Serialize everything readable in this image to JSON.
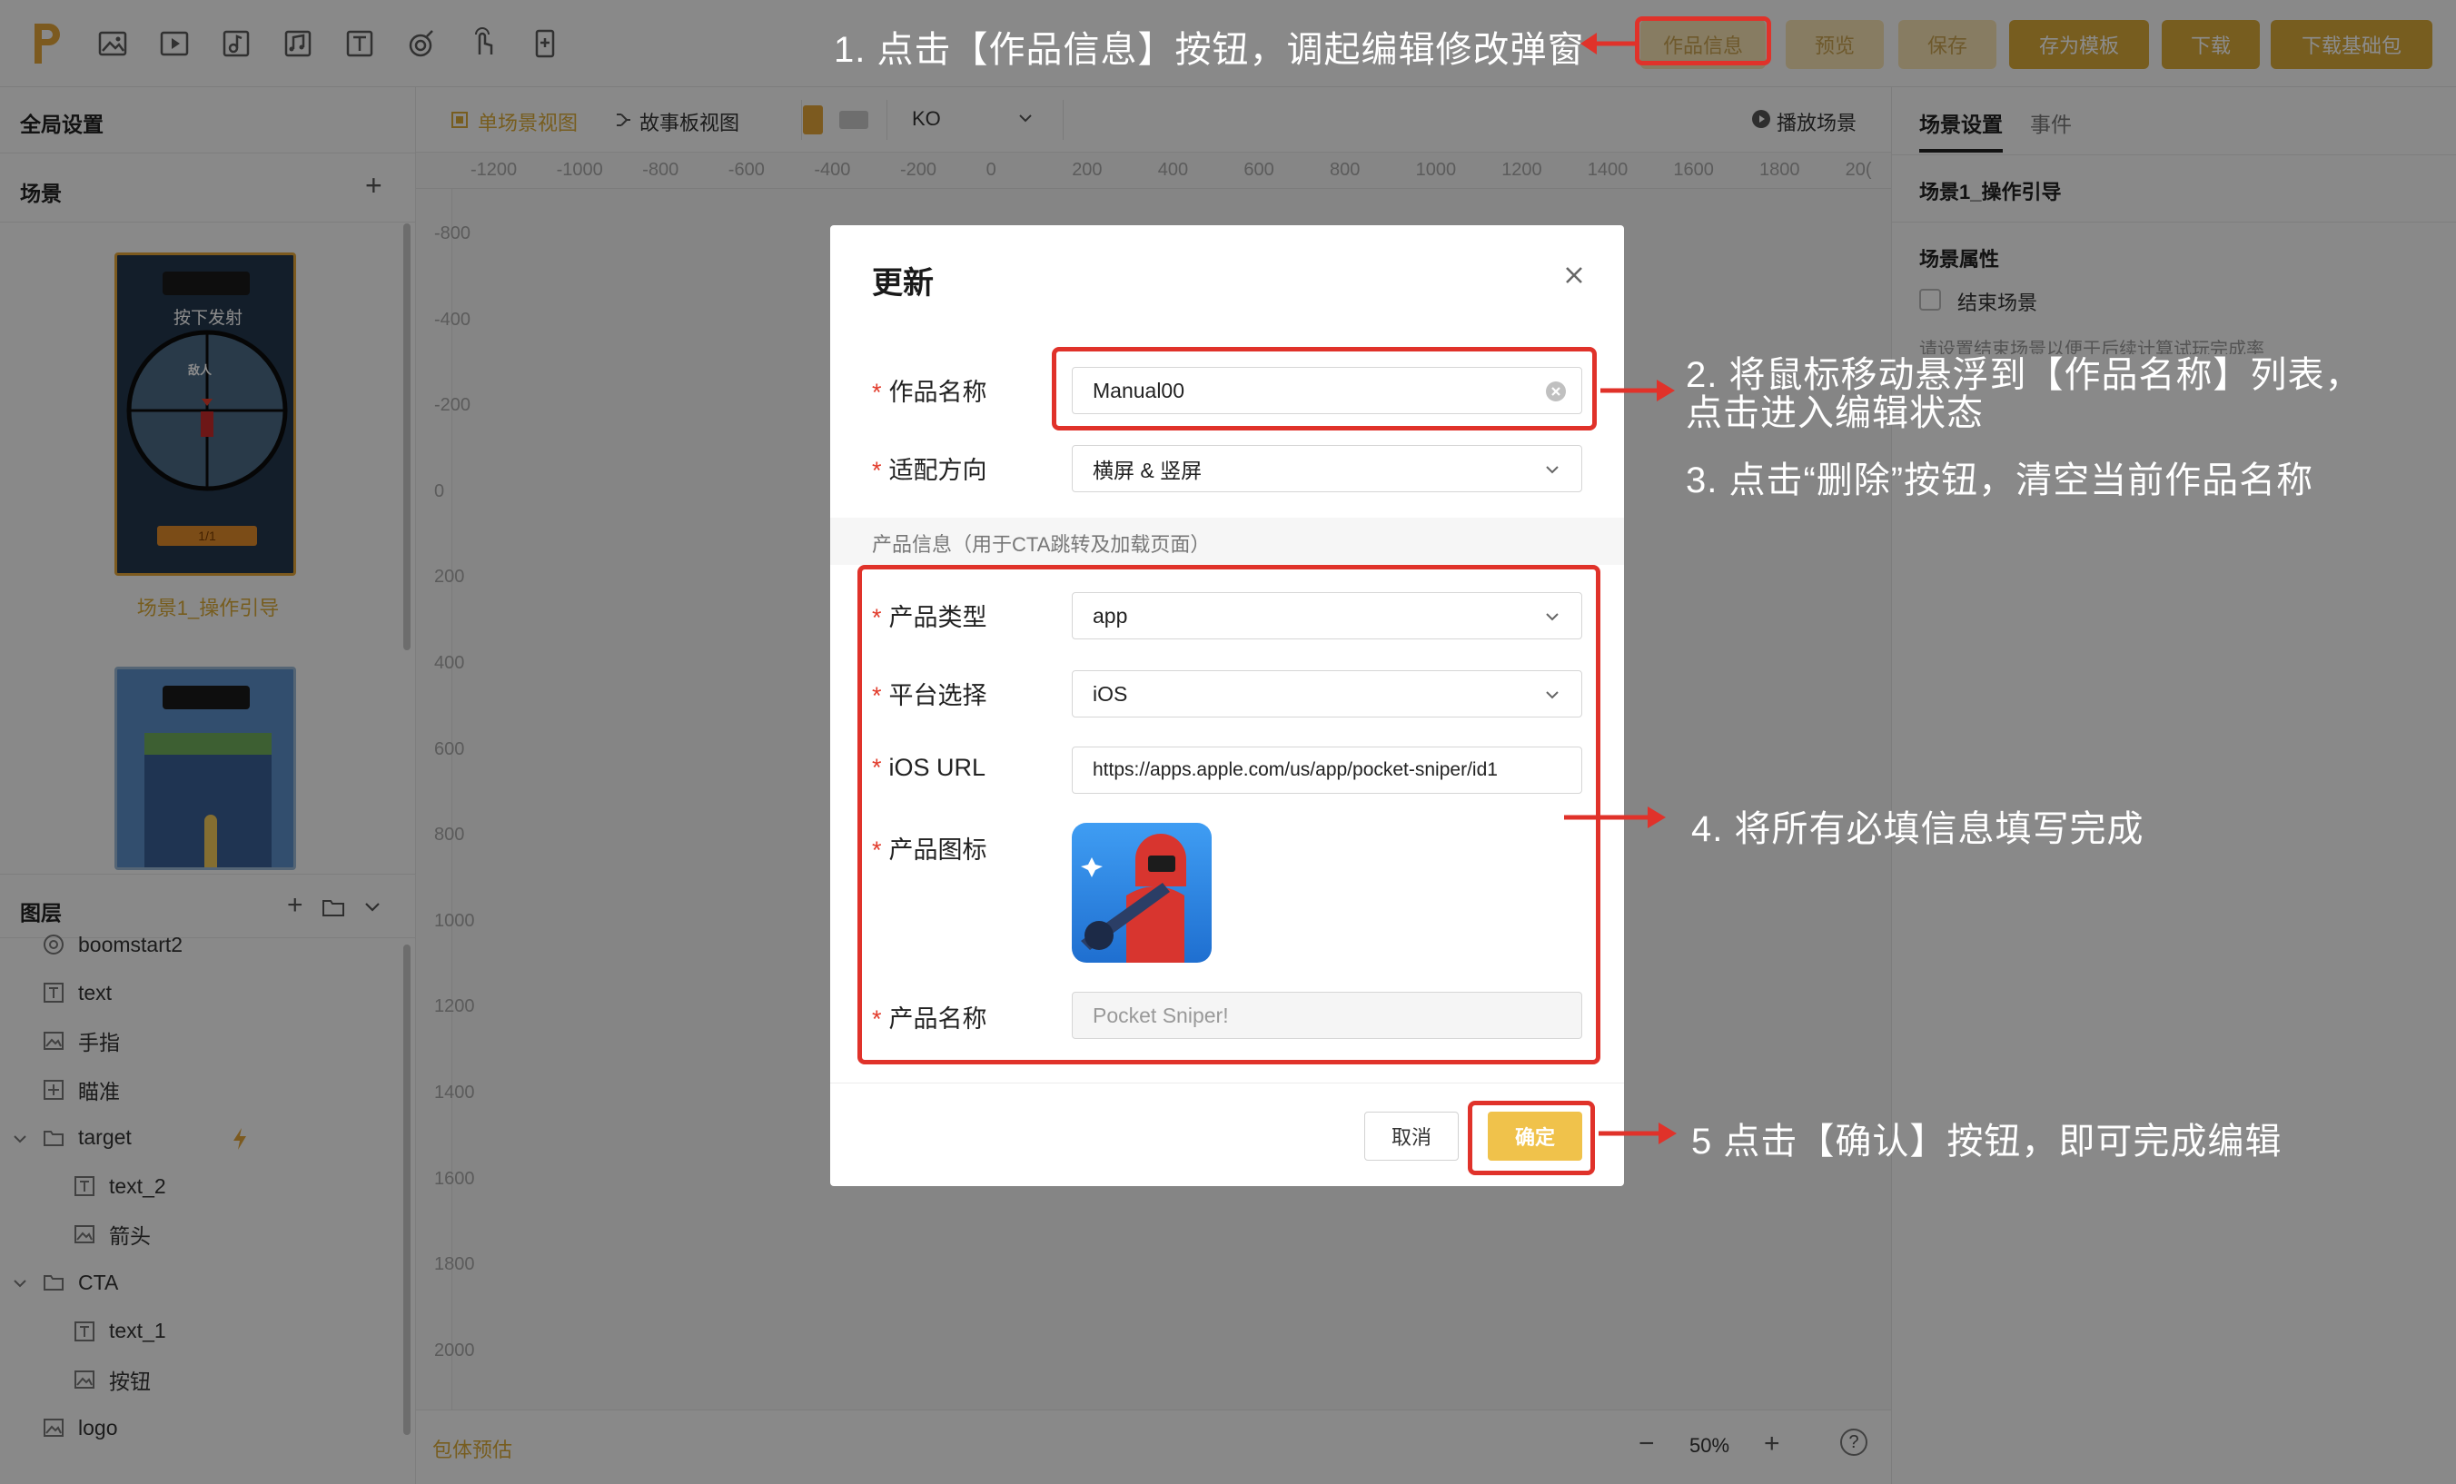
{
  "topbar": {
    "buttons": {
      "product_info": "作品信息",
      "preview": "预览",
      "save": "保存",
      "save_template": "存为模板",
      "download": "下载",
      "download_base": "下载基础包"
    }
  },
  "left": {
    "global_settings": "全局设置",
    "scenes_title": "场景",
    "add": "+",
    "scene1": {
      "banner": "按下发射",
      "enemy": "敌人",
      "bar": "1/1",
      "label": "场景1_操作引导"
    },
    "layers_title": "图层",
    "layers": [
      {
        "label": "boomstart2",
        "icon": "target-icon"
      },
      {
        "label": "text",
        "icon": "text-icon"
      },
      {
        "label": "手指",
        "icon": "image-icon"
      },
      {
        "label": "瞄准",
        "icon": "aim-icon"
      },
      {
        "label": "target",
        "icon": "folder-icon"
      },
      {
        "label": "text_2",
        "icon": "text-icon"
      },
      {
        "label": "箭头",
        "icon": "image-icon"
      },
      {
        "label": "CTA",
        "icon": "folder-icon"
      },
      {
        "label": "text_1",
        "icon": "text-icon"
      },
      {
        "label": "按钮",
        "icon": "image-icon"
      },
      {
        "label": "logo",
        "icon": "image-icon"
      }
    ]
  },
  "canvas": {
    "tabs": {
      "single": "单场景视图",
      "story": "故事板视图"
    },
    "lang": "KO",
    "play": "播放场景",
    "ruler_h": [
      "-1200",
      "-1000",
      "-800",
      "-600",
      "-400",
      "-200",
      "0",
      "200",
      "400",
      "600",
      "800",
      "1000",
      "1200",
      "1400",
      "1600",
      "1800",
      "20("
    ],
    "ruler_v": [
      "-800",
      "-400",
      "-200",
      "0",
      "200",
      "400",
      "600",
      "800",
      "1000",
      "1200",
      "1400",
      "1600",
      "1800",
      "2000"
    ],
    "bottom": {
      "package_estimate": "包体预估",
      "zoom": "50%",
      "minus": "−",
      "plus": "+",
      "help": "?"
    }
  },
  "right": {
    "tab_scene": "场景设置",
    "tab_event": "事件",
    "scene_name": "场景1_操作引导",
    "attr_title": "场景属性",
    "end_scene": "结束场景",
    "hint": "请设置结束场景以便于后续计算试玩完成率"
  },
  "modal": {
    "title": "更新",
    "fields": {
      "work_name_label": "作品名称",
      "work_name_value": "Manual00",
      "orientation_label": "适配方向",
      "orientation_value": "横屏 & 竖屏",
      "section": "产品信息（用于CTA跳转及加载页面）",
      "product_type_label": "产品类型",
      "product_type_value": "app",
      "platform_label": "平台选择",
      "platform_value": "iOS",
      "ios_url_label": "iOS URL",
      "ios_url_value": "https://apps.apple.com/us/app/pocket-sniper/id1",
      "icon_label": "产品图标",
      "product_name_label": "产品名称",
      "product_name_placeholder": "Pocket Sniper!"
    },
    "required_mark": "*",
    "cancel": "取消",
    "ok": "确定"
  },
  "annotations": {
    "step1": "1. 点击【作品信息】按钮，调起编辑修改弹窗",
    "step2_line1": "2. 将鼠标移动悬浮到【作品名称】列表，",
    "step2_line2": "点击进入编辑状态",
    "step3": "3. 点击“删除”按钮，清空当前作品名称",
    "step4": "4. 将所有必填信息填写完成",
    "step5": "5 点击【确认】按钮，即可完成编辑"
  },
  "colors": {
    "accent": "#d9a93a",
    "annotation_red": "#e0322a",
    "confirm": "#f0c24b"
  }
}
